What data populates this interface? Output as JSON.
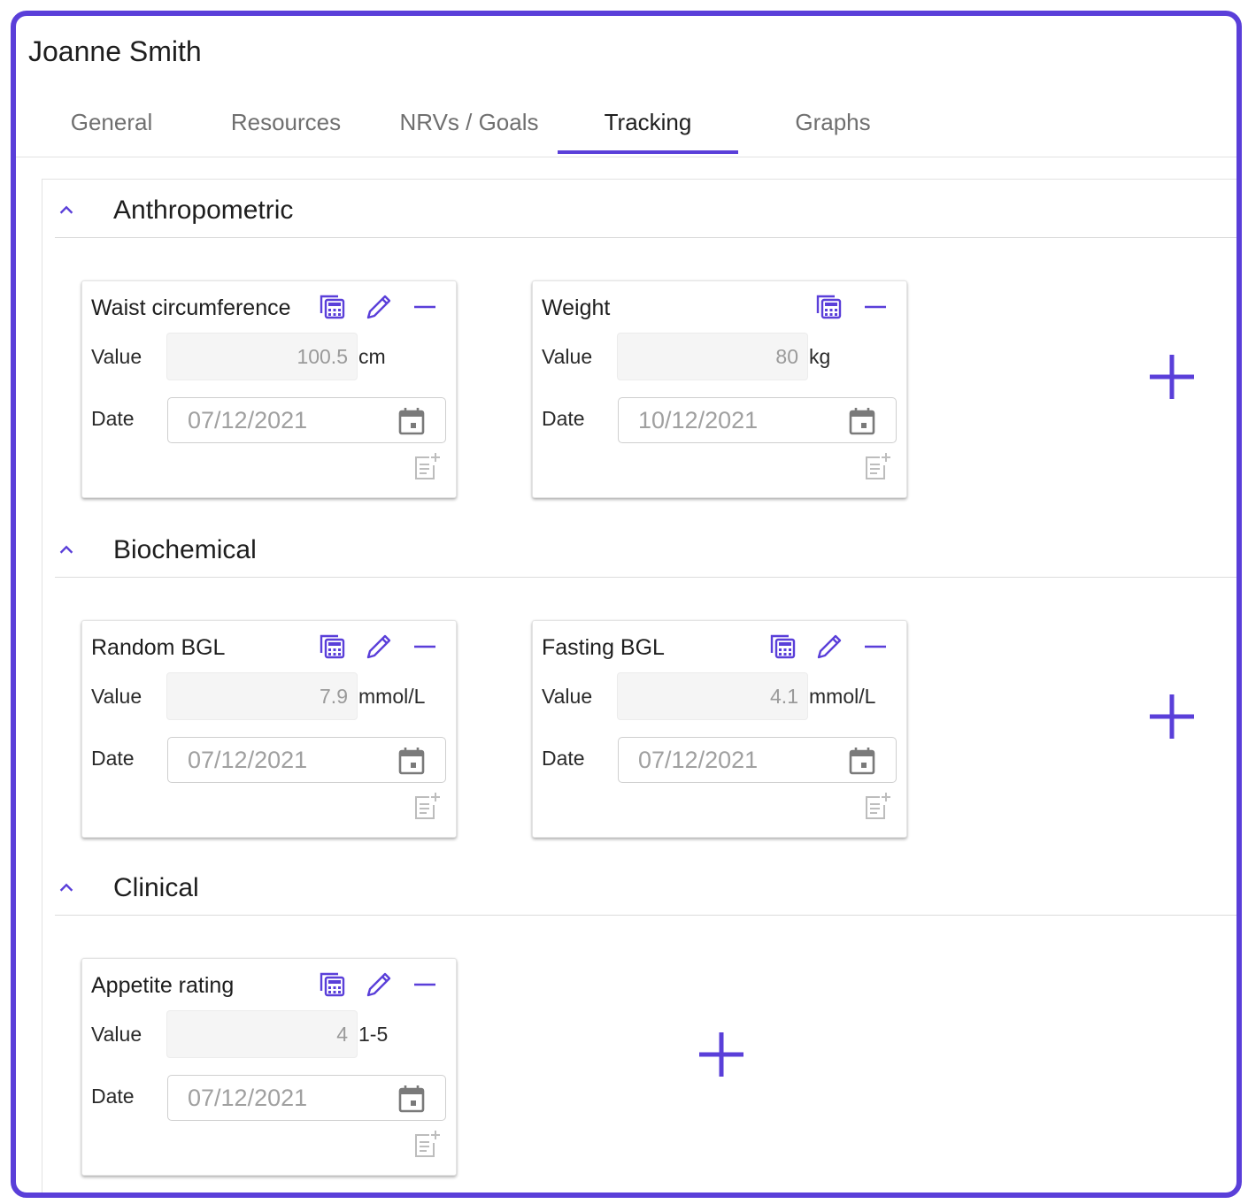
{
  "patient": {
    "name": "Joanne Smith"
  },
  "tabs": [
    {
      "label": "General"
    },
    {
      "label": "Resources"
    },
    {
      "label": "NRVs / Goals"
    },
    {
      "label": "Tracking",
      "active": true
    },
    {
      "label": "Graphs"
    }
  ],
  "labels": {
    "value": "Value",
    "date": "Date"
  },
  "sections": [
    {
      "title": "Anthropometric",
      "cards": [
        {
          "title": "Waist circumference",
          "value": "100.5",
          "unit": "cm",
          "date": "07/12/2021",
          "editable": true
        },
        {
          "title": "Weight",
          "value": "80",
          "unit": "kg",
          "date": "10/12/2021",
          "editable": false
        }
      ]
    },
    {
      "title": "Biochemical",
      "cards": [
        {
          "title": "Random BGL",
          "value": "7.9",
          "unit": "mmol/L",
          "date": "07/12/2021",
          "editable": true
        },
        {
          "title": "Fasting BGL",
          "value": "4.1",
          "unit": "mmol/L",
          "date": "07/12/2021",
          "editable": true
        }
      ]
    },
    {
      "title": "Clinical",
      "cards": [
        {
          "title": "Appetite rating",
          "value": "4",
          "unit": "1-5",
          "date": "07/12/2021",
          "editable": true
        }
      ]
    }
  ],
  "icons": {
    "collapse": "chevron-up-icon",
    "calculator": "calculator-icon",
    "edit": "pencil-icon",
    "remove": "minus-icon",
    "calendar": "calendar-icon",
    "add_note": "note-add-icon",
    "add": "plus-icon"
  },
  "colors": {
    "accent": "#5a3fd9",
    "border": "#5a3fd9",
    "muted_icon": "#bdbdbd"
  }
}
